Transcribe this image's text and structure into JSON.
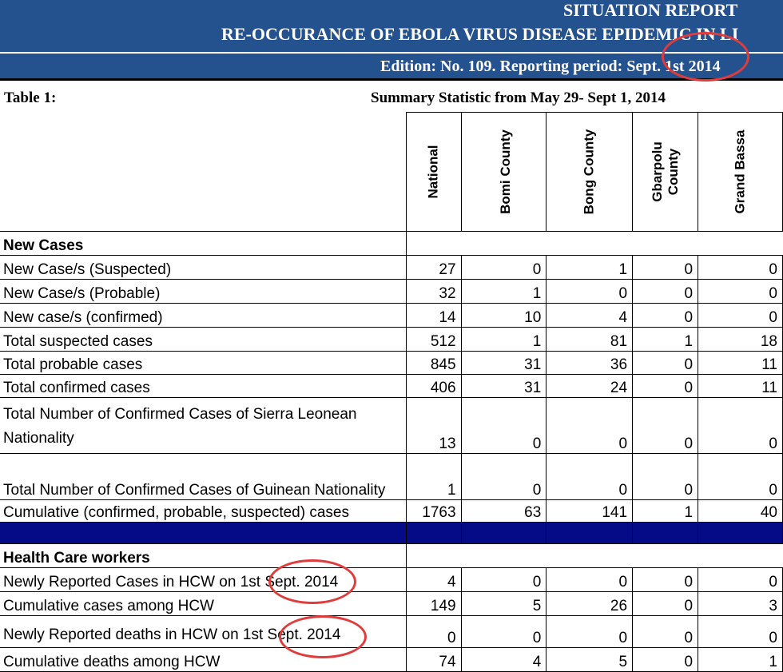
{
  "header": {
    "title_line1": "SITUATION REPORT",
    "title_line2": "RE-OCCURANCE  OF EBOLA VIRUS DISEASE EPIDEMIC IN LI",
    "edition": "Edition: No. 109. Reporting period: Sept. 1st 2014"
  },
  "caption": {
    "table_label": "Table 1:",
    "summary": "Summary Statistic from May 29- Sept 1, 2014"
  },
  "columns": [
    "National",
    "Bomi County",
    "Bong County",
    "Gbarpolu County",
    "Grand Bassa"
  ],
  "sections": {
    "new_cases": "New Cases",
    "hcw": "Health Care workers"
  },
  "rows": [
    {
      "label": "New Case/s (Suspected)",
      "values": [
        "27",
        "0",
        "1",
        "0",
        "0"
      ]
    },
    {
      "label": "New Case/s (Probable)",
      "values": [
        "32",
        "1",
        "0",
        "0",
        "0"
      ]
    },
    {
      "label": "New case/s (confirmed)",
      "values": [
        "14",
        "10",
        "4",
        "0",
        "0"
      ]
    },
    {
      "label": "Total suspected cases",
      "values": [
        "512",
        "1",
        "81",
        "1",
        "18"
      ]
    },
    {
      "label": "Total probable cases",
      "values": [
        "845",
        "31",
        "36",
        "0",
        "11"
      ]
    },
    {
      "label": "Total confirmed cases",
      "values": [
        "406",
        "31",
        "24",
        "0",
        "11"
      ]
    },
    {
      "label": "Total Number of Confirmed Cases of Sierra Leonean",
      "label2": "Nationality",
      "values": [
        "13",
        "0",
        "0",
        "0",
        "0"
      ]
    },
    {
      "label": "Total Number of Confirmed Cases of Guinean Nationality",
      "values": [
        "1",
        "0",
        "0",
        "0",
        "0"
      ]
    },
    {
      "label": "Cumulative (confirmed, probable, suspected) cases",
      "values": [
        "1763",
        "63",
        "141",
        "1",
        "40"
      ]
    }
  ],
  "hcw_rows": [
    {
      "label": "Newly Reported Cases in HCW on 1st Sept. 2014",
      "values": [
        "4",
        "0",
        "0",
        "0",
        "0"
      ]
    },
    {
      "label": "Cumulative  cases among HCW",
      "values": [
        "149",
        "5",
        "26",
        "0",
        "3"
      ]
    },
    {
      "label": "Newly Reported deaths in HCW on 1st Sept. 2014",
      "values": [
        "0",
        "0",
        "0",
        "0",
        "0"
      ]
    },
    {
      "label": "Cumulative  deaths among HCW",
      "values": [
        "74",
        "4",
        "5",
        "0",
        "1"
      ]
    }
  ],
  "annotation_color": "#e03c3c",
  "header_color": "#24528e",
  "separator_color": "#050a86"
}
